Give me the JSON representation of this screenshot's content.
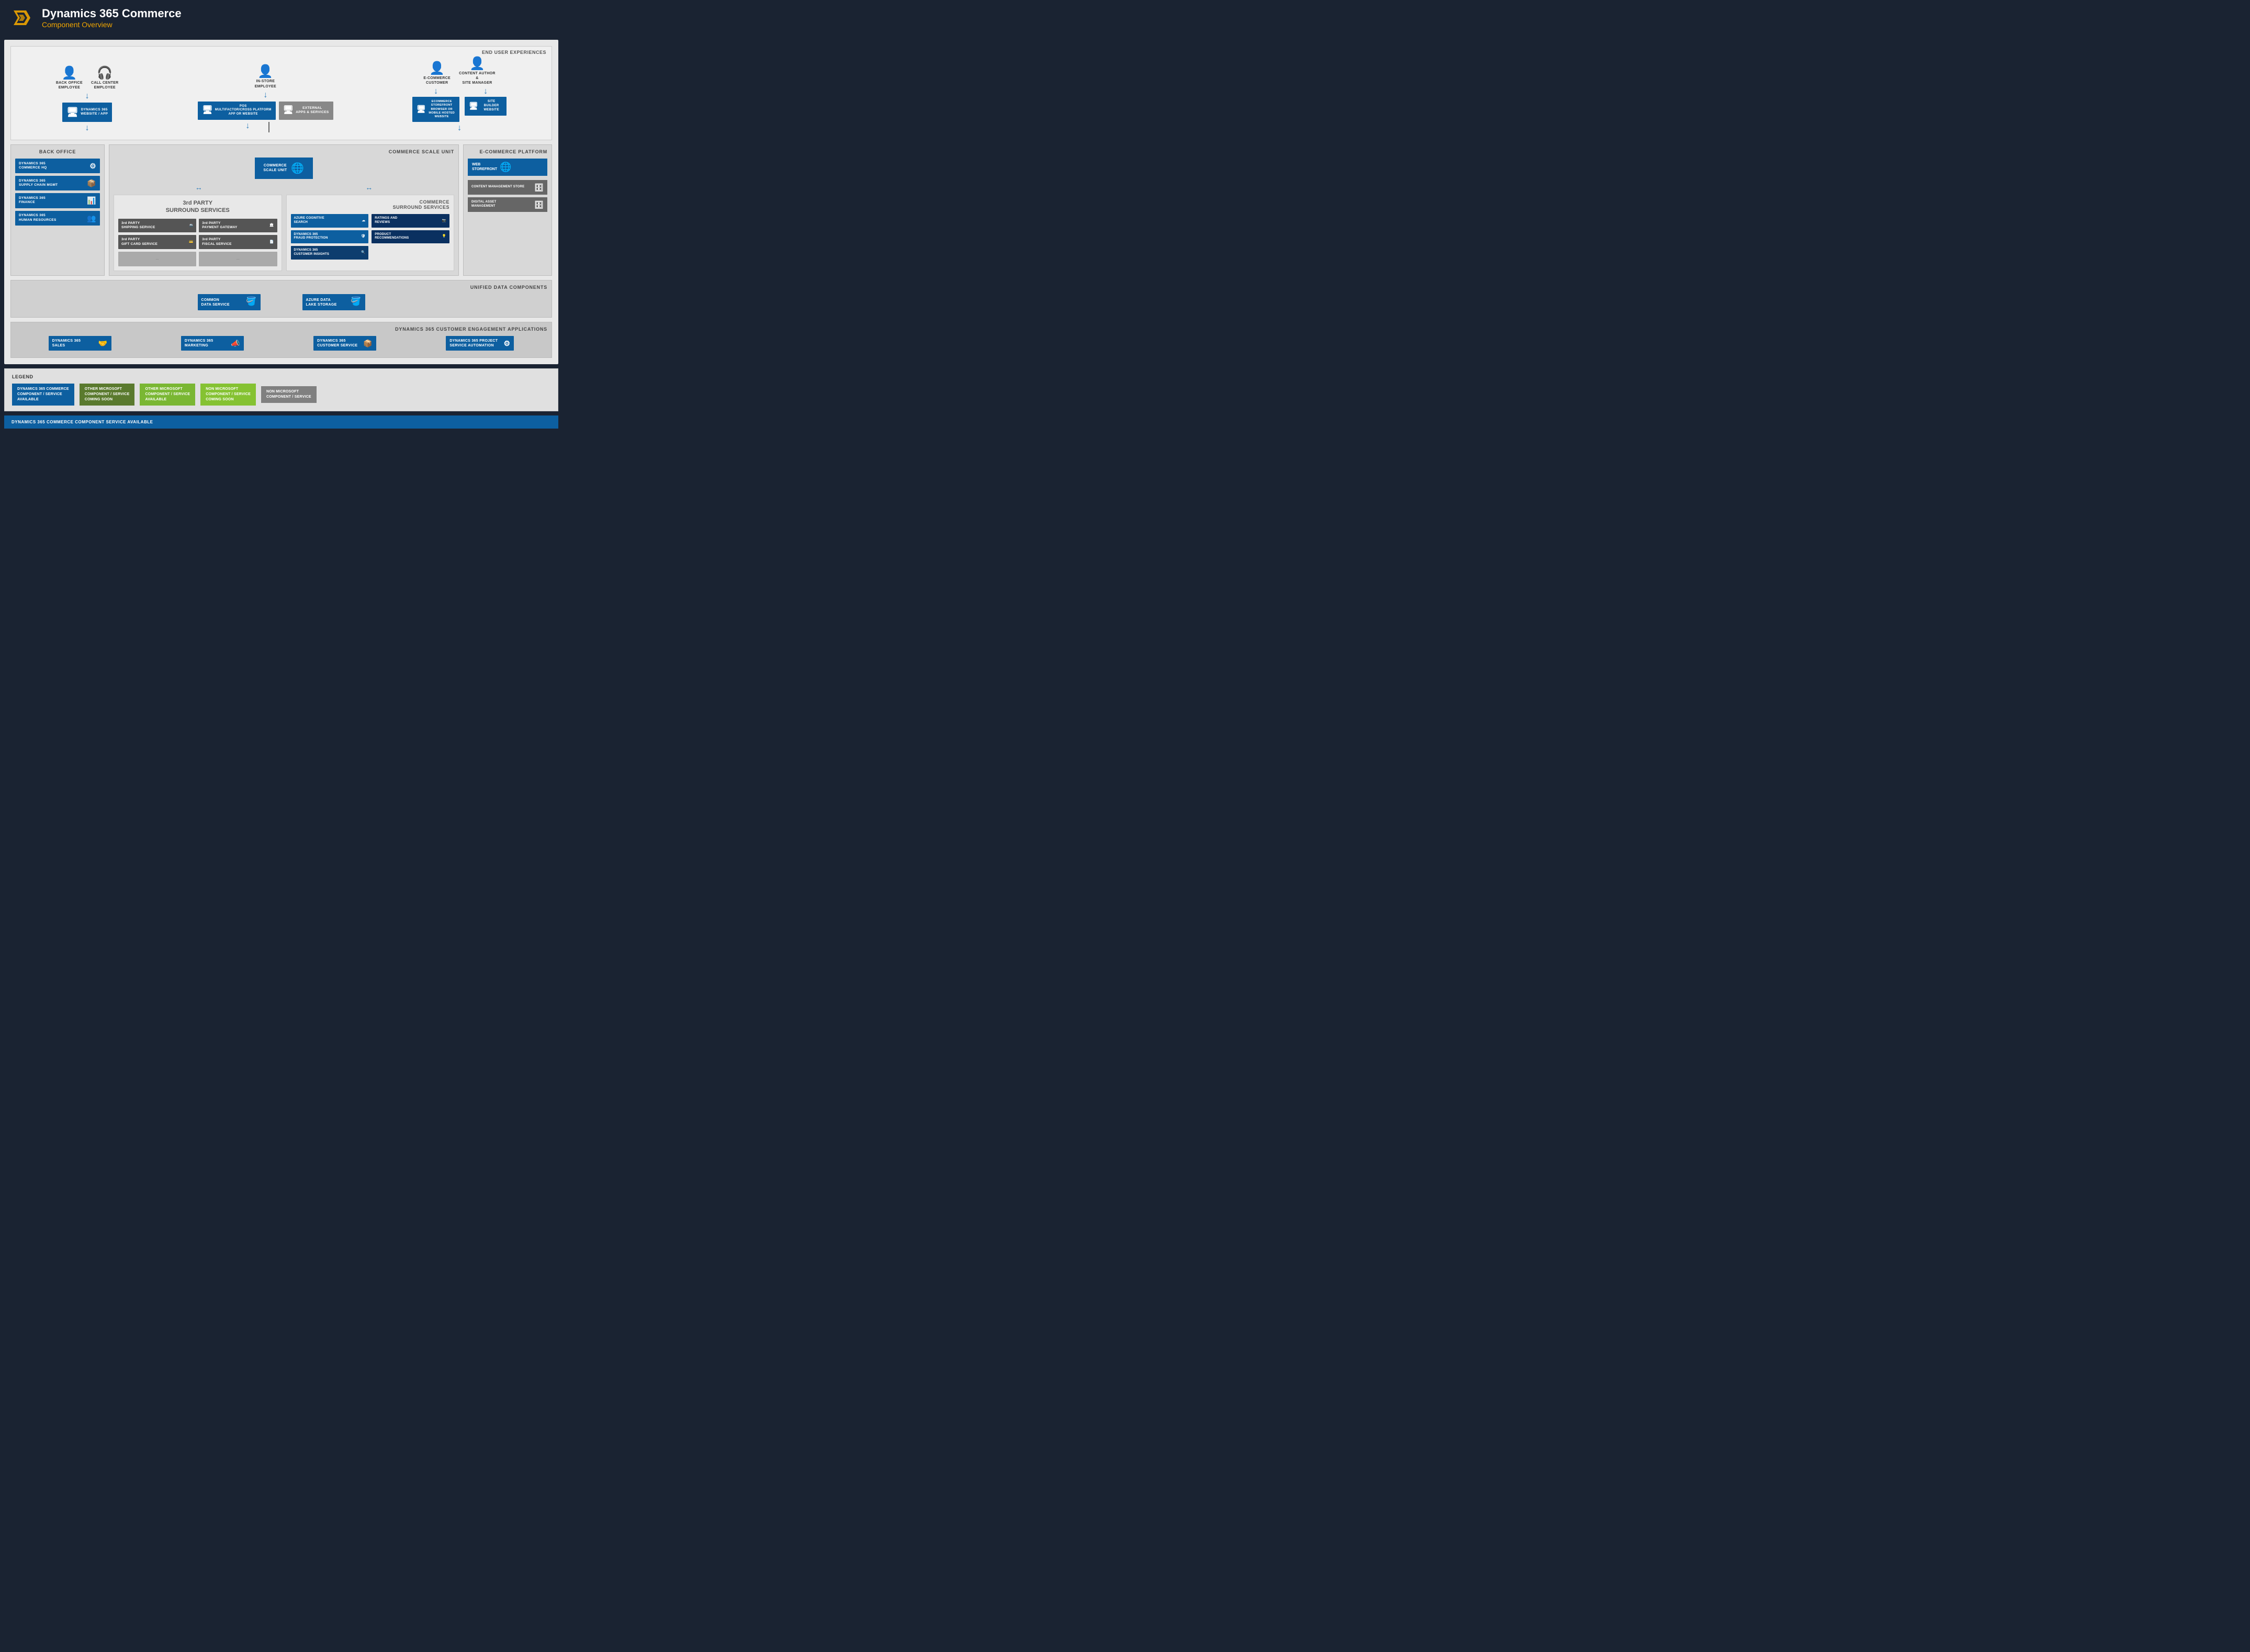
{
  "header": {
    "title": "Dynamics 365 Commerce",
    "subtitle": "Component Overview"
  },
  "sections": {
    "end_user_experiences": "END USER EXPERIENCES",
    "back_office": "BACK OFFICE",
    "commerce_scale_unit": "COMMERCE SCALE UNIT",
    "ecommerce_platform": "E-COMMERCE PLATFORM",
    "unified_data": "UNIFIED DATA COMPONENTS",
    "engagement": "DYNAMICS 365 CUSTOMER ENGAGEMENT APPLICATIONS"
  },
  "users": [
    {
      "label": "BACK OFFICE\nEMPLOYEE"
    },
    {
      "label": "CALL CENTER\nEMPLOYEE"
    },
    {
      "label": "IN-STORE\nEMPLOYEE"
    },
    {
      "label": "E-COMMERCE\nCUSTOMER"
    },
    {
      "label": "CONTENT AUTHOR &\nSITE MANAGER"
    }
  ],
  "devices": [
    {
      "label": "DYNAMICS 365\nWEBSITE / APP",
      "type": "blue"
    },
    {
      "label": "POS\nMULTIFACTOR/CROSS PLATFORM\nAPP OR WEBSITE",
      "type": "blue"
    },
    {
      "label": "EXTERNAL\nAPPS & SERVICES",
      "type": "gray"
    },
    {
      "label": "ECOMMERCE STOREFRONT\nBROWSER OR MOBILE HOSTED\nWEBSITE",
      "type": "blue"
    },
    {
      "label": "SITE BUILDER\nWEBSITE",
      "type": "blue"
    }
  ],
  "back_office_services": [
    {
      "label": "DYNAMICS 365\nCOMMERCE HQ",
      "icon": "⚙"
    },
    {
      "label": "DYNAMICS 365\nSUPPLY CHAIN MGMT",
      "icon": "📦"
    },
    {
      "label": "DYNAMICS 365\nFINANCE",
      "icon": "📊"
    },
    {
      "label": "DYNAMICS 365\nHUMAN RESOURCES",
      "icon": "👥"
    }
  ],
  "csu": {
    "label": "COMMERCE\nSCALE UNIT"
  },
  "third_party": {
    "title": "3rd PARTY\nSURROUND SERVICES",
    "items": [
      {
        "label": "3rd PARTY\nSHIPPING SERVICE",
        "icon": "🚢"
      },
      {
        "label": "3rd PARTY\nPAYMENT GATEWAY",
        "icon": "🏛"
      },
      {
        "label": "3rd PARTY\nGIFT CARD SERVICE",
        "icon": "💳"
      },
      {
        "label": "3rd PARTY\nFISCAL SERVICE",
        "icon": "📄"
      }
    ]
  },
  "commerce_surround": {
    "title": "COMMERCE\nSURROUND SERVICES",
    "left_items": [
      {
        "label": "AZURE COGNITIVE\nSEARCH",
        "icon": "🔍",
        "type": "blue"
      },
      {
        "label": "DYNAMICS 365\nFRAUD PROTECTION",
        "icon": "🛡",
        "type": "blue"
      },
      {
        "label": "DYNAMICS 365\nCUSTOMER INSIGHTS",
        "icon": "🔍",
        "type": "blue-dark"
      }
    ],
    "right_items": [
      {
        "label": "RATINGS AND\nREVIEWS",
        "icon": "📷",
        "type": "dark-blue"
      },
      {
        "label": "PRODUCT\nRECOMMENDATIONS",
        "icon": "💡",
        "type": "dark-blue"
      }
    ]
  },
  "ecommerce_services": [
    {
      "label": "CONTENT MANAGEMENT STORE",
      "icon": "🗄"
    },
    {
      "label": "DIGITAL ASSET\nMANAGEMENT",
      "icon": "🗄"
    }
  ],
  "unified_data": [
    {
      "label": "COMMON\nDATA SERVICE",
      "icon": "🪣"
    },
    {
      "label": "AZURE DATA\nLAKE STORAGE",
      "icon": "🪣"
    }
  ],
  "engagement_apps": [
    {
      "label": "DYNAMICS 365\nSALES",
      "icon": "🤝"
    },
    {
      "label": "DYNAMICS 365\nMARKETING",
      "icon": "📣"
    },
    {
      "label": "DYNAMICS 365\nCUSTOMER SERVICE",
      "icon": "📦"
    },
    {
      "label": "DYNAMICS 365 PROJECT\nSERVICE AUTOMATION",
      "icon": "⚙"
    }
  ],
  "legend": {
    "title": "LEGEND",
    "items": [
      {
        "label": "DYNAMICS 365 COMMERCE\nCOMPONENT / SERVICE\nAVAILABLE",
        "color": "blue"
      },
      {
        "label": "OTHER MICROSOFT\nCOMPONENT / SERVICE\nCOMING SOON",
        "color": "green-dark"
      },
      {
        "label": "OTHER MICROSOFT\nCOMPONENT / SERVICE\nAVAILABLE",
        "color": "green-light"
      },
      {
        "label": "NON MICROSOFT\nCOMPONENT / SERVICE\nCOMING SOON",
        "color": "green-bright"
      },
      {
        "label": "NON MICROSOFT\nCOMPONENT / SERVICE",
        "color": "gray"
      }
    ]
  },
  "available_label": "DYNAMICS 365 COMMERCE COMPONENT SERVICE AVAILABLE"
}
